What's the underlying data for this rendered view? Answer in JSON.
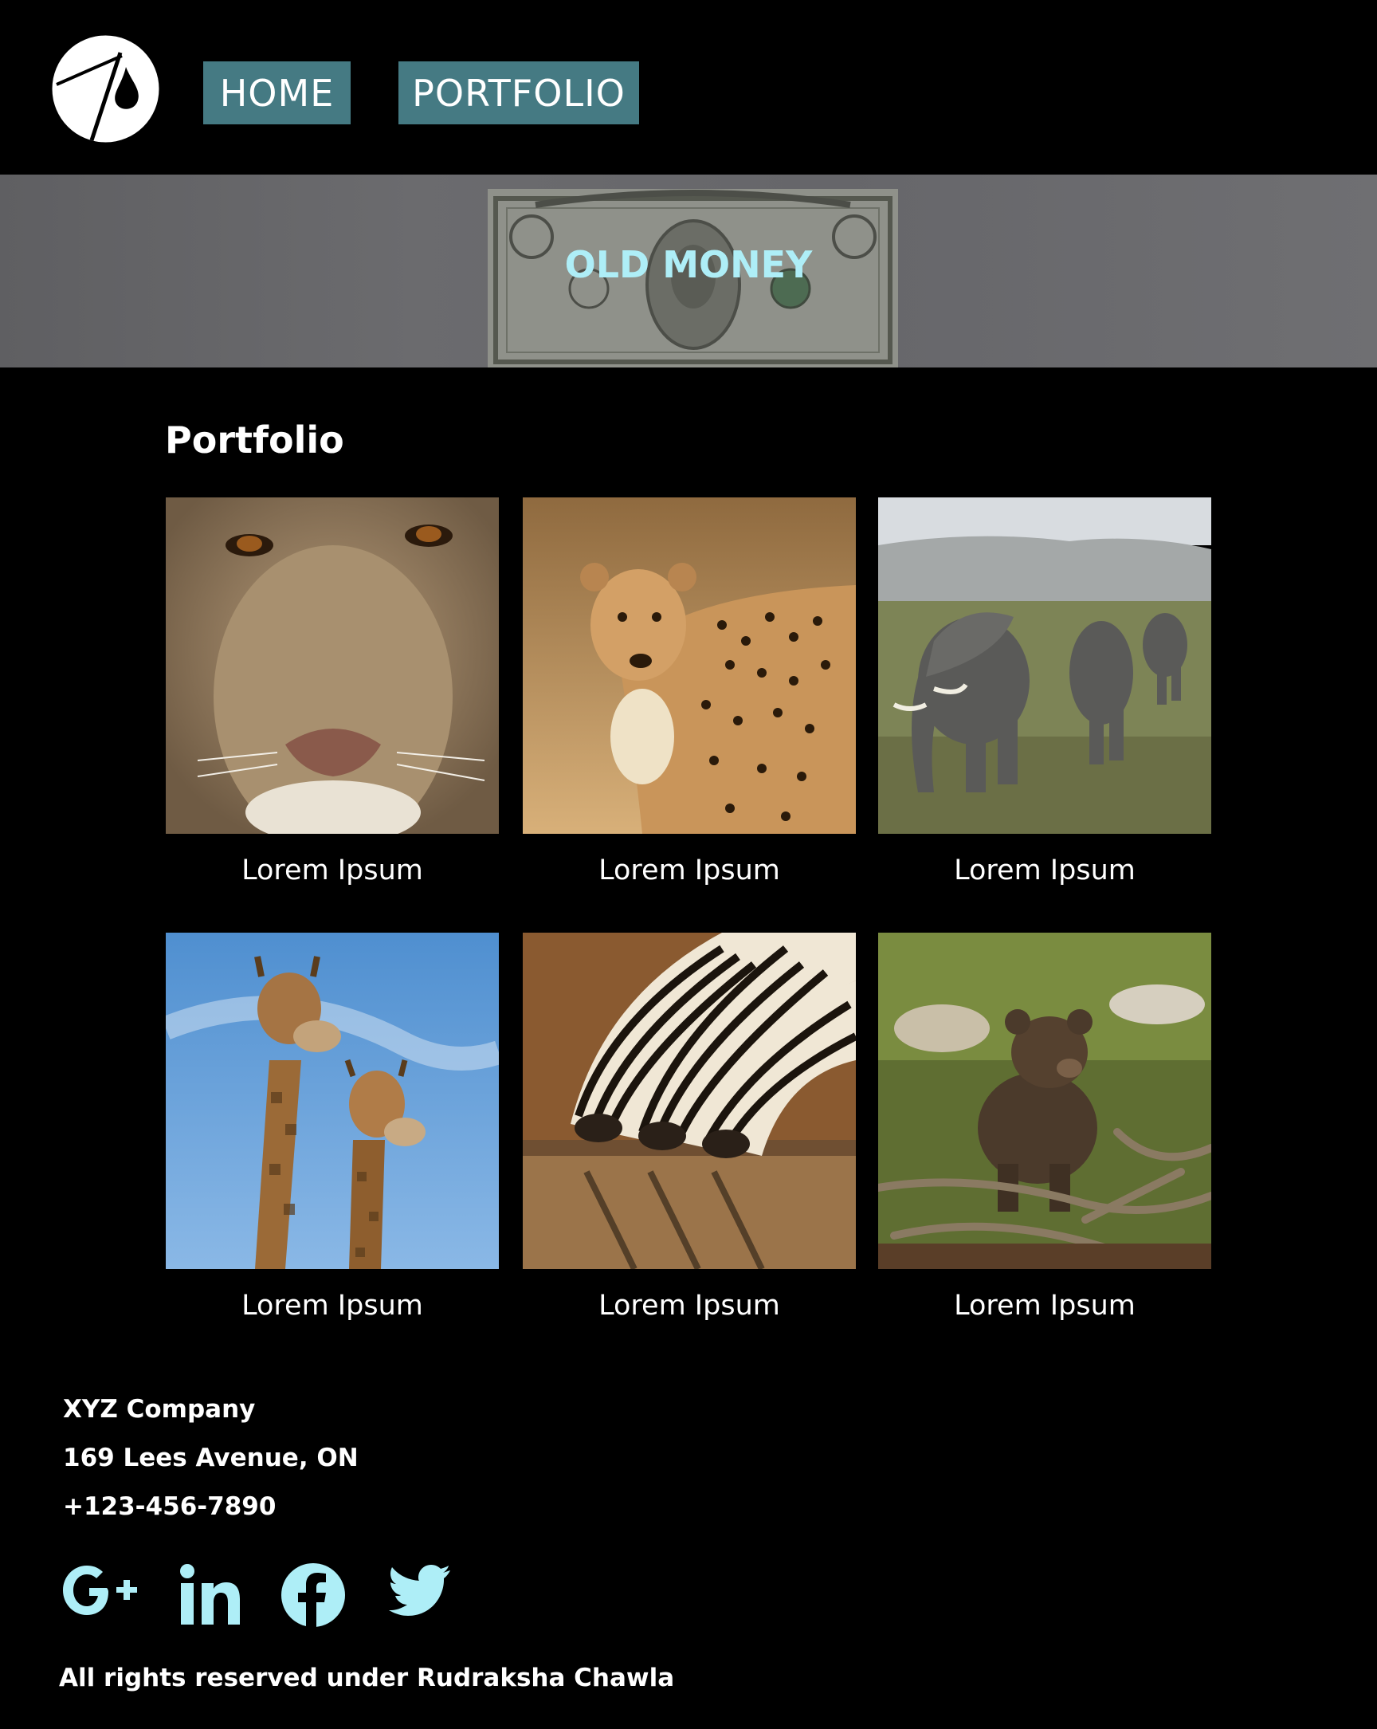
{
  "header": {
    "nav": {
      "home": "HOME",
      "portfolio": "PORTFOLIO"
    },
    "logo_icon": "brand-logo-icon",
    "nav_color": "#457a83"
  },
  "hero": {
    "title": "OLD MONEY",
    "title_color": "#aeeef7",
    "background_image": "dollar-bill"
  },
  "portfolio": {
    "title": "Portfolio",
    "items": [
      {
        "caption": "Lorem Ipsum",
        "image": "lioness"
      },
      {
        "caption": "Lorem Ipsum",
        "image": "cheetah"
      },
      {
        "caption": "Lorem Ipsum",
        "image": "elephants"
      },
      {
        "caption": "Lorem Ipsum",
        "image": "giraffes"
      },
      {
        "caption": "Lorem Ipsum",
        "image": "zebras"
      },
      {
        "caption": "Lorem Ipsum",
        "image": "bear-cub"
      }
    ]
  },
  "footer": {
    "company": "XYZ Company",
    "address": "169  Lees Avenue, ON",
    "phone": "+123-456-7890",
    "social": [
      "google-plus-icon",
      "linkedin-icon",
      "facebook-icon",
      "twitter-icon"
    ],
    "social_color": "#aeeef7",
    "copyright": "All rights reserved under Rudraksha Chawla"
  }
}
